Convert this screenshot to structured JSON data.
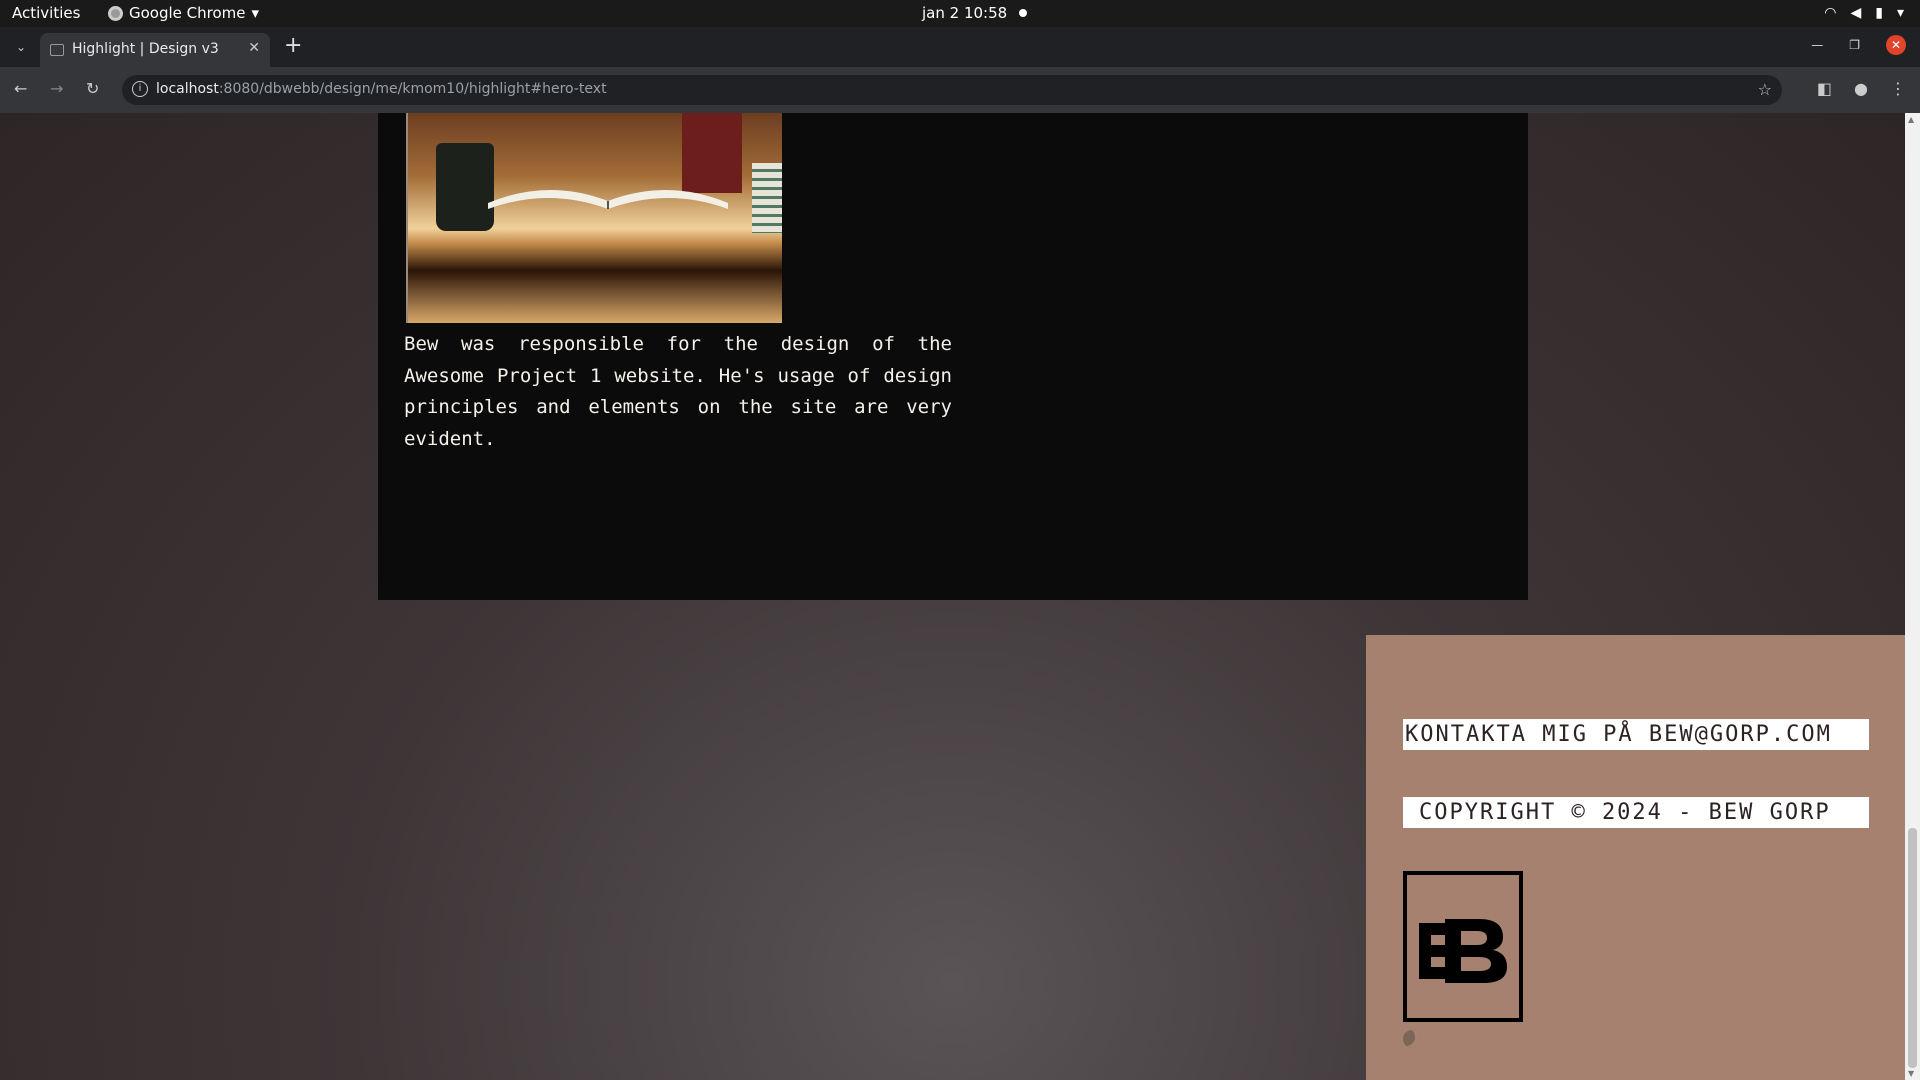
{
  "system": {
    "activities": "Activities",
    "app_name": "Google Chrome",
    "clock": "jan 2  10:58"
  },
  "browser": {
    "tab_title": "Highlight | Design v3",
    "url_host": "localhost",
    "url_path": ":8080/dbwebb/design/me/kmom10/highlight#hero-text"
  },
  "page": {
    "hero_text": "Bew was responsible for the design of the Awesome Project 1 website. He's usage of design principles and elements on the site are very evident.",
    "footer": {
      "contact": "KONTAKTA MIG PÅ BEW@GORP.COM",
      "copyright": "COPYRIGHT © 2024 - BEW GORP"
    }
  },
  "icons": {
    "tab_search": "chevron-down-icon",
    "new_tab": "plus-icon",
    "back": "arrow-left-icon",
    "forward": "arrow-right-icon",
    "reload": "reload-icon",
    "bookmark": "star-icon",
    "theme": "moon-icon"
  },
  "colors": {
    "panel_bg": "#0c0b0b",
    "footer_bg": "#a78170",
    "text_light": "#f4f0ea"
  }
}
